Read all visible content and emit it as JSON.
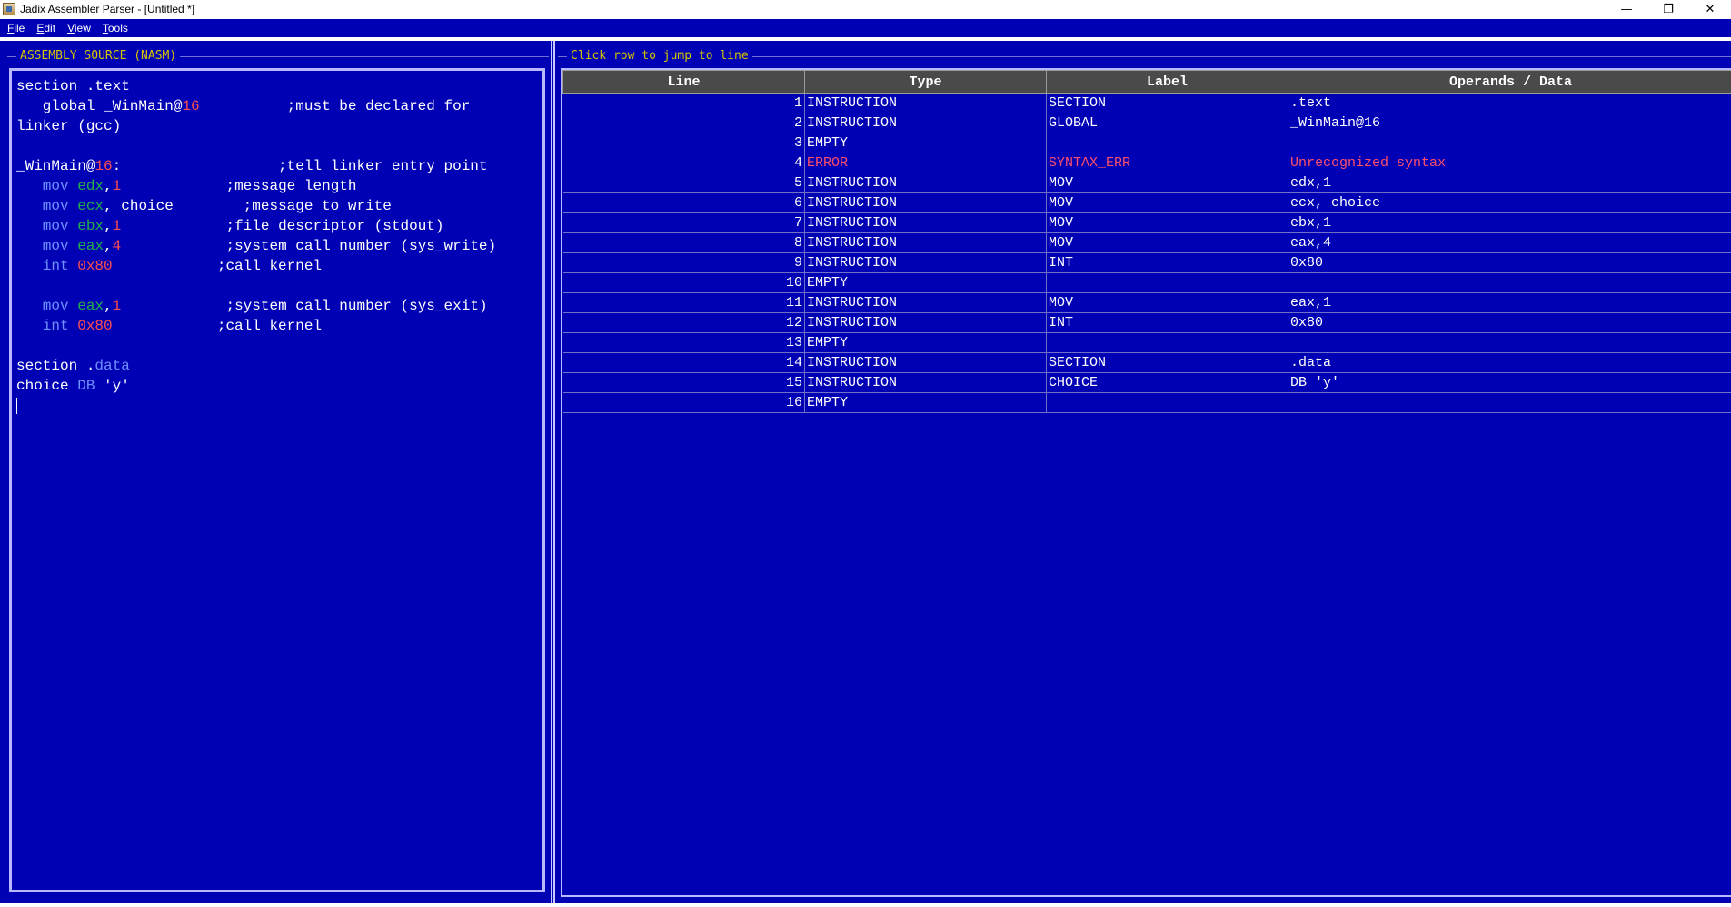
{
  "window": {
    "title": "Jadix Assembler Parser - [Untitled *]",
    "controls": {
      "minimize": "—",
      "restore": "❐",
      "close": "✕"
    }
  },
  "menu": [
    "File",
    "Edit",
    "View",
    "Tools"
  ],
  "editor": {
    "title": "ASSEMBLY SOURCE (NASM)",
    "lines": [
      [
        {
          "t": "section .text",
          "c": ""
        }
      ],
      [
        {
          "t": "   global _WinMain@",
          "c": ""
        },
        {
          "t": "16",
          "c": "num"
        },
        {
          "t": "          ;must be declared for",
          "c": ""
        }
      ],
      [
        {
          "t": "linker (gcc)",
          "c": ""
        }
      ],
      [
        {
          "t": "",
          "c": ""
        }
      ],
      [
        {
          "t": "_WinMain@",
          "c": ""
        },
        {
          "t": "16",
          "c": "num"
        },
        {
          "t": ":                  ;tell linker entry point",
          "c": ""
        }
      ],
      [
        {
          "t": "   mov ",
          "c": "kw"
        },
        {
          "t": "edx",
          "c": "reg"
        },
        {
          "t": ",",
          "c": ""
        },
        {
          "t": "1",
          "c": "num"
        },
        {
          "t": "            ;message length",
          "c": ""
        }
      ],
      [
        {
          "t": "   mov ",
          "c": "kw"
        },
        {
          "t": "ecx",
          "c": "reg"
        },
        {
          "t": ", choice        ;message to write",
          "c": ""
        }
      ],
      [
        {
          "t": "   mov ",
          "c": "kw"
        },
        {
          "t": "ebx",
          "c": "reg"
        },
        {
          "t": ",",
          "c": ""
        },
        {
          "t": "1",
          "c": "num"
        },
        {
          "t": "            ;file descriptor (stdout)",
          "c": ""
        }
      ],
      [
        {
          "t": "   mov ",
          "c": "kw"
        },
        {
          "t": "eax",
          "c": "reg"
        },
        {
          "t": ",",
          "c": ""
        },
        {
          "t": "4",
          "c": "num"
        },
        {
          "t": "            ;system call number (sys_write)",
          "c": ""
        }
      ],
      [
        {
          "t": "   int ",
          "c": "kw"
        },
        {
          "t": "0x80",
          "c": "num"
        },
        {
          "t": "            ;call kernel",
          "c": ""
        }
      ],
      [
        {
          "t": "",
          "c": ""
        }
      ],
      [
        {
          "t": "   mov ",
          "c": "kw"
        },
        {
          "t": "eax",
          "c": "reg"
        },
        {
          "t": ",",
          "c": ""
        },
        {
          "t": "1",
          "c": "num"
        },
        {
          "t": "            ;system call number (sys_exit)",
          "c": ""
        }
      ],
      [
        {
          "t": "   int ",
          "c": "kw"
        },
        {
          "t": "0x80",
          "c": "num"
        },
        {
          "t": "            ;call kernel",
          "c": ""
        }
      ],
      [
        {
          "t": "",
          "c": ""
        }
      ],
      [
        {
          "t": "section .",
          "c": ""
        },
        {
          "t": "data",
          "c": "dir"
        }
      ],
      [
        {
          "t": "choice ",
          "c": ""
        },
        {
          "t": "DB",
          "c": "kw"
        },
        {
          "t": " 'y'",
          "c": ""
        }
      ]
    ]
  },
  "table": {
    "title": "Click row to jump to line",
    "headers": [
      "Line",
      "Type",
      "Label",
      "Operands / Data"
    ],
    "rows": [
      {
        "line": "1",
        "type": "INSTRUCTION",
        "label": "SECTION",
        "ops": ".text",
        "error": false
      },
      {
        "line": "2",
        "type": "INSTRUCTION",
        "label": "GLOBAL",
        "ops": "_WinMain@16",
        "error": false
      },
      {
        "line": "3",
        "type": "EMPTY",
        "label": "",
        "ops": "",
        "error": false
      },
      {
        "line": "4",
        "type": "ERROR",
        "label": "SYNTAX_ERR",
        "ops": "Unrecognized syntax",
        "error": true
      },
      {
        "line": "5",
        "type": "INSTRUCTION",
        "label": "MOV",
        "ops": "edx,1",
        "error": false
      },
      {
        "line": "6",
        "type": "INSTRUCTION",
        "label": "MOV",
        "ops": "ecx, choice",
        "error": false
      },
      {
        "line": "7",
        "type": "INSTRUCTION",
        "label": "MOV",
        "ops": "ebx,1",
        "error": false
      },
      {
        "line": "8",
        "type": "INSTRUCTION",
        "label": "MOV",
        "ops": "eax,4",
        "error": false
      },
      {
        "line": "9",
        "type": "INSTRUCTION",
        "label": "INT",
        "ops": "0x80",
        "error": false
      },
      {
        "line": "10",
        "type": "EMPTY",
        "label": "",
        "ops": "",
        "error": false
      },
      {
        "line": "11",
        "type": "INSTRUCTION",
        "label": "MOV",
        "ops": "eax,1",
        "error": false
      },
      {
        "line": "12",
        "type": "INSTRUCTION",
        "label": "INT",
        "ops": "0x80",
        "error": false
      },
      {
        "line": "13",
        "type": "EMPTY",
        "label": "",
        "ops": "",
        "error": false
      },
      {
        "line": "14",
        "type": "INSTRUCTION",
        "label": "SECTION",
        "ops": ".data",
        "error": false
      },
      {
        "line": "15",
        "type": "INSTRUCTION",
        "label": "CHOICE",
        "ops": "DB 'y'",
        "error": false
      },
      {
        "line": "16",
        "type": "EMPTY",
        "label": "",
        "ops": "",
        "error": false
      }
    ]
  }
}
